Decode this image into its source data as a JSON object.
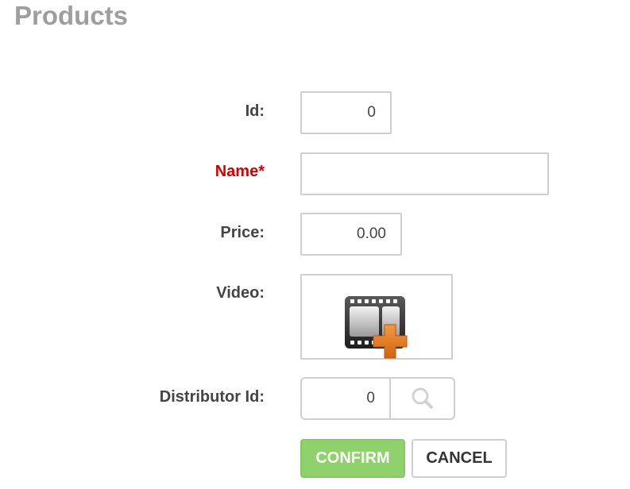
{
  "page": {
    "title": "Products"
  },
  "form": {
    "id": {
      "label": "Id:",
      "value": "0"
    },
    "name": {
      "label": "Name*",
      "value": "",
      "required": true
    },
    "price": {
      "label": "Price:",
      "value": "0.00"
    },
    "video": {
      "label": "Video:",
      "icon": "add-video-icon"
    },
    "distributor_id": {
      "label": "Distributor Id:",
      "value": "0",
      "lookup_icon": "search-icon"
    }
  },
  "actions": {
    "confirm_label": "CONFIRM",
    "cancel_label": "CANCEL"
  },
  "colors": {
    "title": "#9e9e9e",
    "label": "#444444",
    "required_label": "#d40000",
    "confirm_bg": "#8fd16a",
    "border": "#cfcfcf",
    "plus_orange": "#e8771e"
  }
}
